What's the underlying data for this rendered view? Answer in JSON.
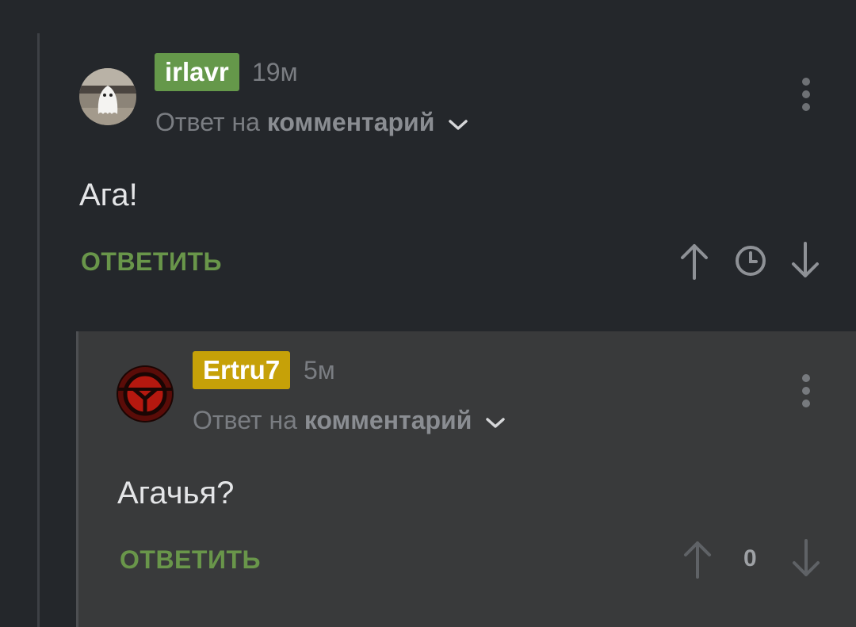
{
  "comments": [
    {
      "username": "irlavr",
      "badge_color": "#65984a",
      "time": "19м",
      "reply_prefix": "Ответ на",
      "reply_target": "комментарий",
      "text": "Ага!",
      "reply_label": "ОТВЕТИТЬ",
      "icons": [
        "more-vertical-icon",
        "arrow-up-icon",
        "clock-icon",
        "arrow-down-icon"
      ]
    },
    {
      "username": "Ertru7",
      "badge_color": "#c6a108",
      "time": "5м",
      "reply_prefix": "Ответ на",
      "reply_target": "комментарий",
      "text": "Агачья?",
      "reply_label": "ОТВЕТИТЬ",
      "score": "0",
      "icons": [
        "more-vertical-icon",
        "arrow-up-icon",
        "arrow-down-icon"
      ]
    }
  ],
  "colors": {
    "background": "#24272b",
    "nested_background": "#393a3b",
    "reply_green": "#69964a"
  }
}
